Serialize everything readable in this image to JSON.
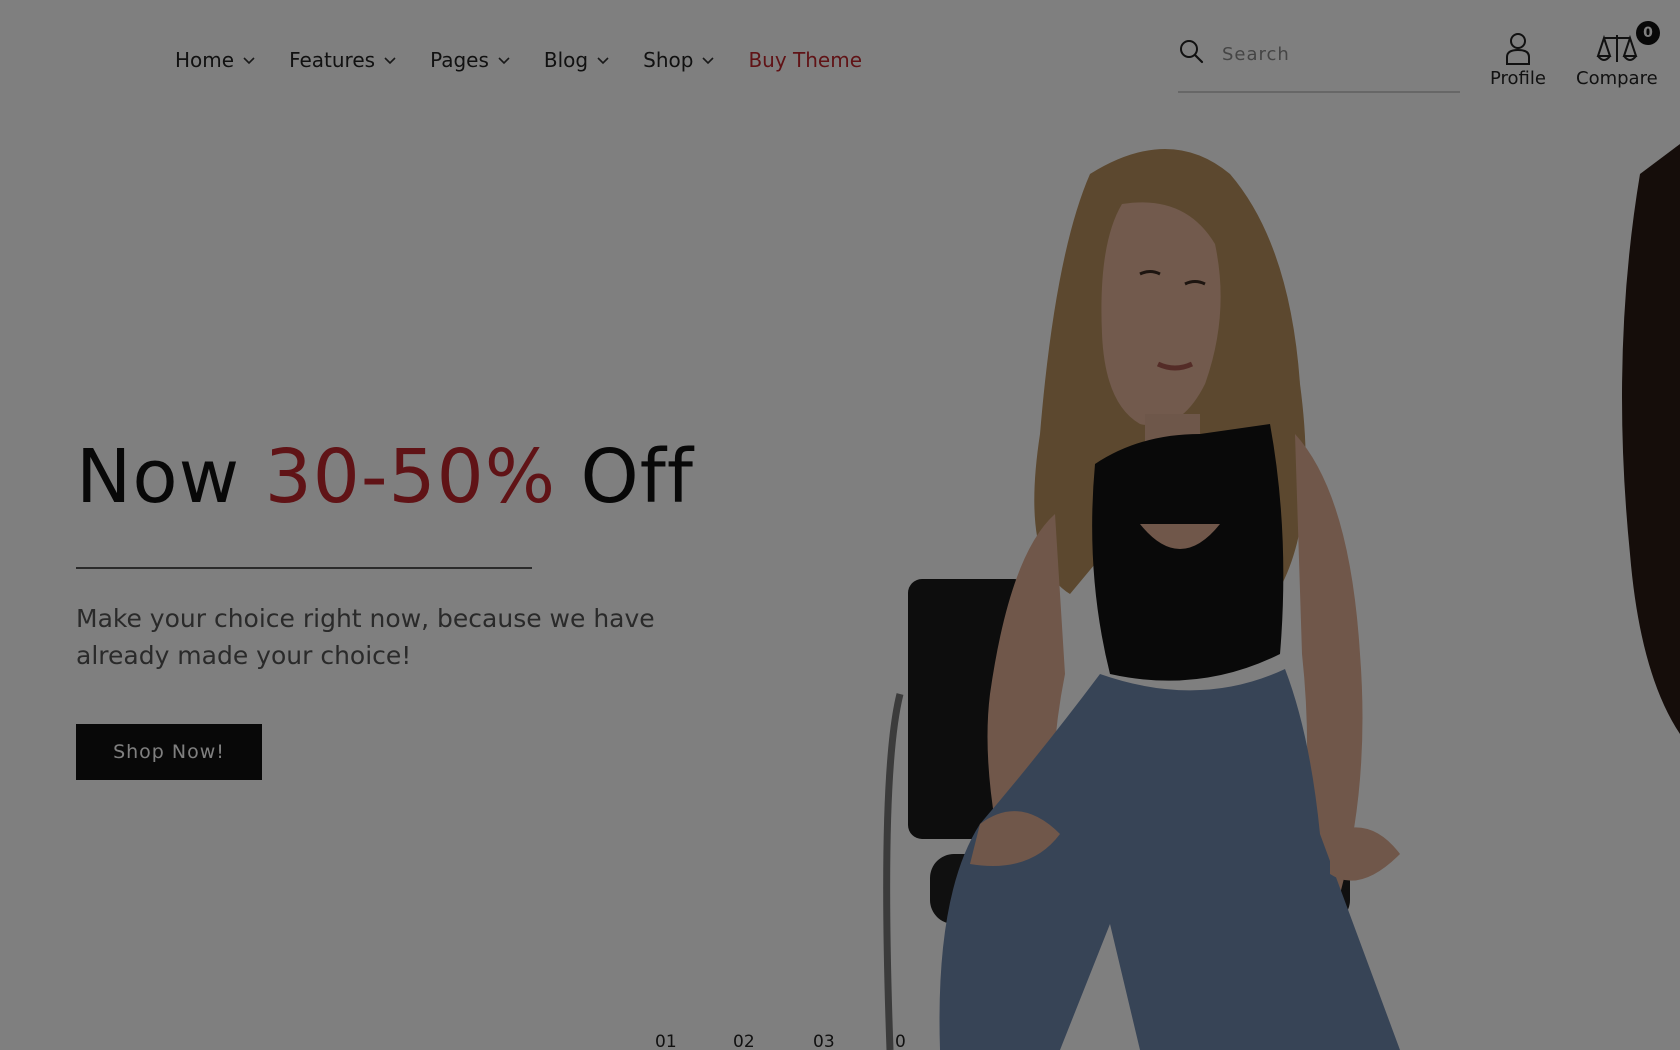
{
  "nav": {
    "items": [
      {
        "label": "Home",
        "has_dropdown": true
      },
      {
        "label": "Features",
        "has_dropdown": true
      },
      {
        "label": "Pages",
        "has_dropdown": true
      },
      {
        "label": "Blog",
        "has_dropdown": true
      },
      {
        "label": "Shop",
        "has_dropdown": true
      },
      {
        "label": "Buy Theme",
        "has_dropdown": false
      }
    ]
  },
  "search": {
    "placeholder": "Search",
    "value": ""
  },
  "header_tools": {
    "profile_label": "Profile",
    "compare_label": "Compare",
    "compare_count": "0"
  },
  "hero": {
    "headline_prefix": "Now ",
    "headline_accent": "30-50%",
    "headline_suffix": " Off",
    "subtitle": "Make your choice right now, because we have already made your choice!",
    "cta_label": "Shop Now!",
    "slides": [
      "01",
      "02",
      "03",
      "0"
    ]
  },
  "colors": {
    "accent": "#c0262d",
    "button_bg": "#111111",
    "overlay": "rgba(0,0,0,0.5)"
  }
}
